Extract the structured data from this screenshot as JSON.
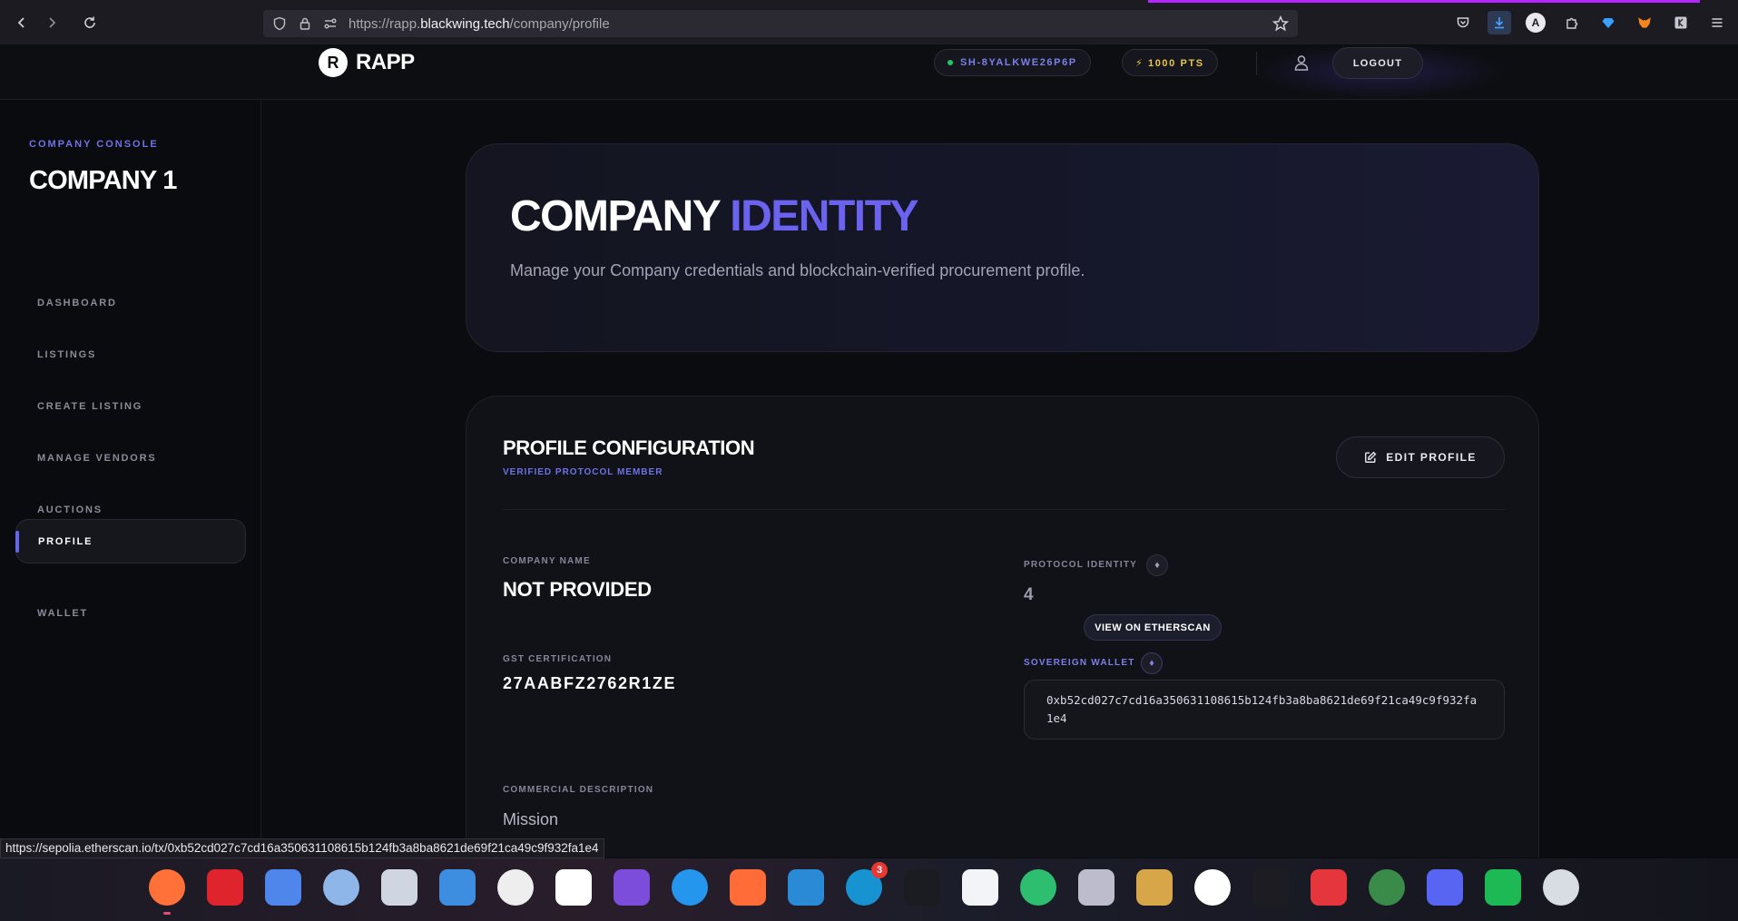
{
  "browser": {
    "url_prefix": "https://rapp.",
    "url_host": "blackwing.tech",
    "url_path": "/company/profile",
    "profile_initial": "A"
  },
  "header": {
    "logo_mark": "R",
    "logo_text": "RAPP",
    "session_id": "SH-8YALKWE26P6P",
    "points": "⚡ 1000 PTS",
    "logout_label": "LOGOUT"
  },
  "sidebar": {
    "console_label": "COMPANY CONSOLE",
    "company_title": "COMPANY 1",
    "items": [
      {
        "label": "DASHBOARD"
      },
      {
        "label": "LISTINGS"
      },
      {
        "label": "CREATE LISTING"
      },
      {
        "label": "MANAGE VENDORS"
      },
      {
        "label": "AUCTIONS"
      },
      {
        "label": "PROFILE",
        "active": true
      },
      {
        "label": "WALLET"
      }
    ]
  },
  "hero": {
    "title_main": "COMPANY",
    "title_accent": "IDENTITY",
    "description": "Manage your Company credentials and blockchain-verified procurement profile."
  },
  "profile": {
    "title": "PROFILE CONFIGURATION",
    "subtitle": "VERIFIED PROTOCOL MEMBER",
    "edit_label": "EDIT PROFILE",
    "company_name_label": "COMPANY NAME",
    "company_name_value": "NOT PROVIDED",
    "gst_label": "GST CERTIFICATION",
    "gst_value": "27AABFZ2762R1ZE",
    "protocol_label": "PROTOCOL IDENTITY",
    "protocol_value": "4",
    "etherscan_label": "VIEW ON ETHERSCAN",
    "wallet_label": "SOVEREIGN WALLET",
    "wallet_value": "0xb52cd027c7cd16a350631108615b124fb3a8ba8621de69f21ca49c9f932fa1e4",
    "commercial_label": "COMMERCIAL DESCRIPTION",
    "mission": "Mission"
  },
  "status_url": "https://sepolia.etherscan.io/tx/0xb52cd027c7cd16a350631108615b124fb3a8ba8621de69f21ca49c9f932fa1e4",
  "dock": {
    "notification_count": "3",
    "apps": [
      {
        "name": "firefox-icon",
        "color": "#ff7139"
      },
      {
        "name": "opera-icon",
        "color": "#e0242e"
      },
      {
        "name": "chromium-icon",
        "color": "#4f86ec"
      },
      {
        "name": "files-icon",
        "color": "#8fb6e8"
      },
      {
        "name": "archive-manager-icon",
        "color": "#cfd6e2"
      },
      {
        "name": "document-viewer-icon",
        "color": "#3d8ee0"
      },
      {
        "name": "text-editor-icon",
        "color": "#eeeeee"
      },
      {
        "name": "notion-icon",
        "color": "#ffffff"
      },
      {
        "name": "tasks-icon",
        "color": "#7c4ddb"
      },
      {
        "name": "docker-icon",
        "color": "#2496ed"
      },
      {
        "name": "postman-icon",
        "color": "#ff6c37"
      },
      {
        "name": "vscode-icon",
        "color": "#2a8ad6"
      },
      {
        "name": "arch-updater-icon",
        "color": "#1793d1"
      },
      {
        "name": "intellij-icon",
        "color": "#1b1c22"
      },
      {
        "name": "app-store-icon",
        "color": "#f2f4f8"
      },
      {
        "name": "circle-app-icon",
        "color": "#2dbf6f"
      },
      {
        "name": "cube-app-icon",
        "color": "#bcbccc"
      },
      {
        "name": "dbeaver-icon",
        "color": "#d7a648"
      },
      {
        "name": "mongodb-icon",
        "color": "#ffffff"
      },
      {
        "name": "terminal-icon",
        "color": "#1c1c22"
      },
      {
        "name": "toggle-app-icon",
        "color": "#e5363e"
      },
      {
        "name": "system-monitor-icon",
        "color": "#3a8a4a"
      },
      {
        "name": "discord-icon",
        "color": "#5865f2"
      },
      {
        "name": "spotify-icon",
        "color": "#1db954"
      },
      {
        "name": "trash-icon",
        "color": "#d8dde4"
      }
    ]
  }
}
